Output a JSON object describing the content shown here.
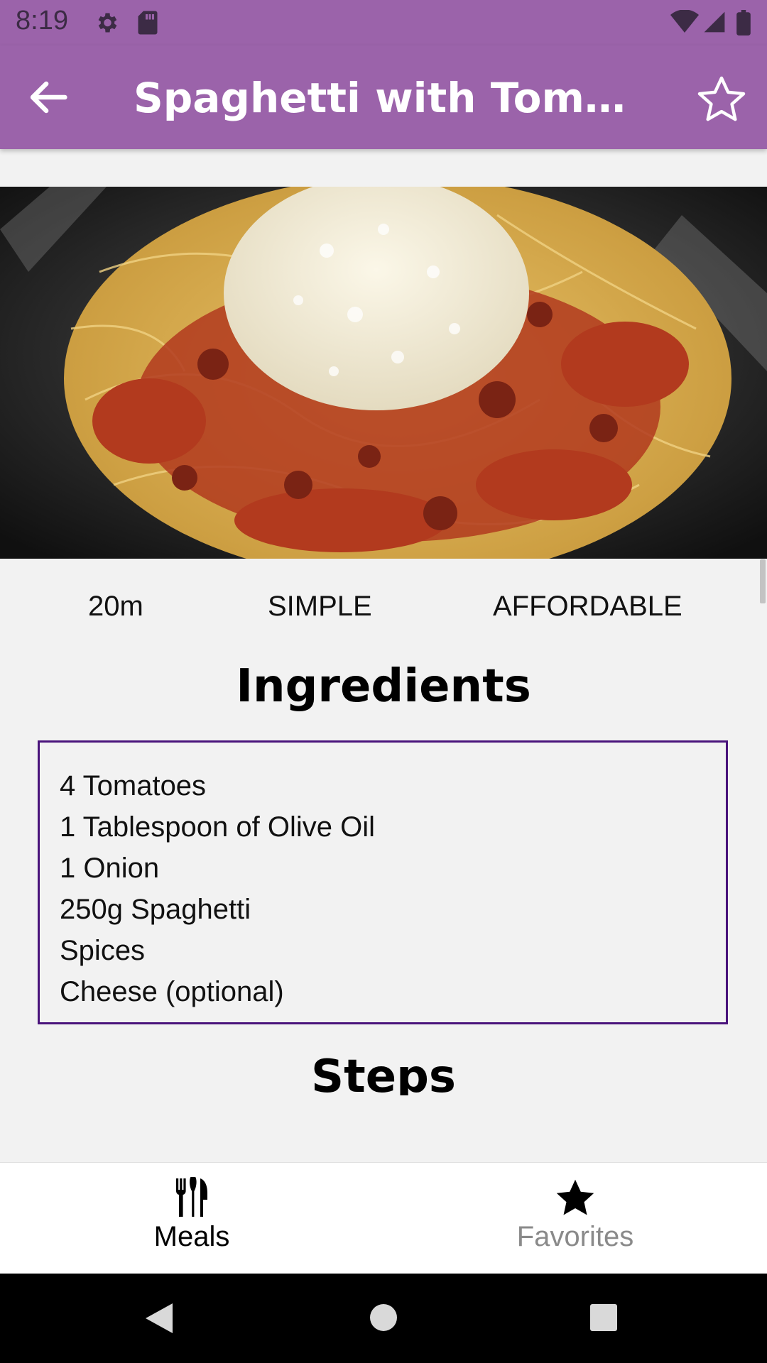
{
  "status_bar": {
    "time": "8:19"
  },
  "app_bar": {
    "title": "Spaghetti with Tomato Sauce"
  },
  "meal": {
    "duration": "20m",
    "complexity": "SIMPLE",
    "affordability": "AFFORDABLE",
    "ingredients_title": "Ingredients",
    "ingredients": [
      "4 Tomatoes",
      "1 Tablespoon of Olive Oil",
      "1 Onion",
      "250g Spaghetti",
      "Spices",
      "Cheese (optional)"
    ],
    "steps_title": "Steps"
  },
  "bottom_nav": {
    "items": [
      {
        "label": "Meals",
        "icon": "cutlery-icon",
        "active": true
      },
      {
        "label": "Favorites",
        "icon": "star-icon",
        "active": false
      }
    ]
  },
  "colors": {
    "app_bar": "#9b63aa",
    "ingredients_border": "#4a147c",
    "background": "#f2f2f2"
  }
}
